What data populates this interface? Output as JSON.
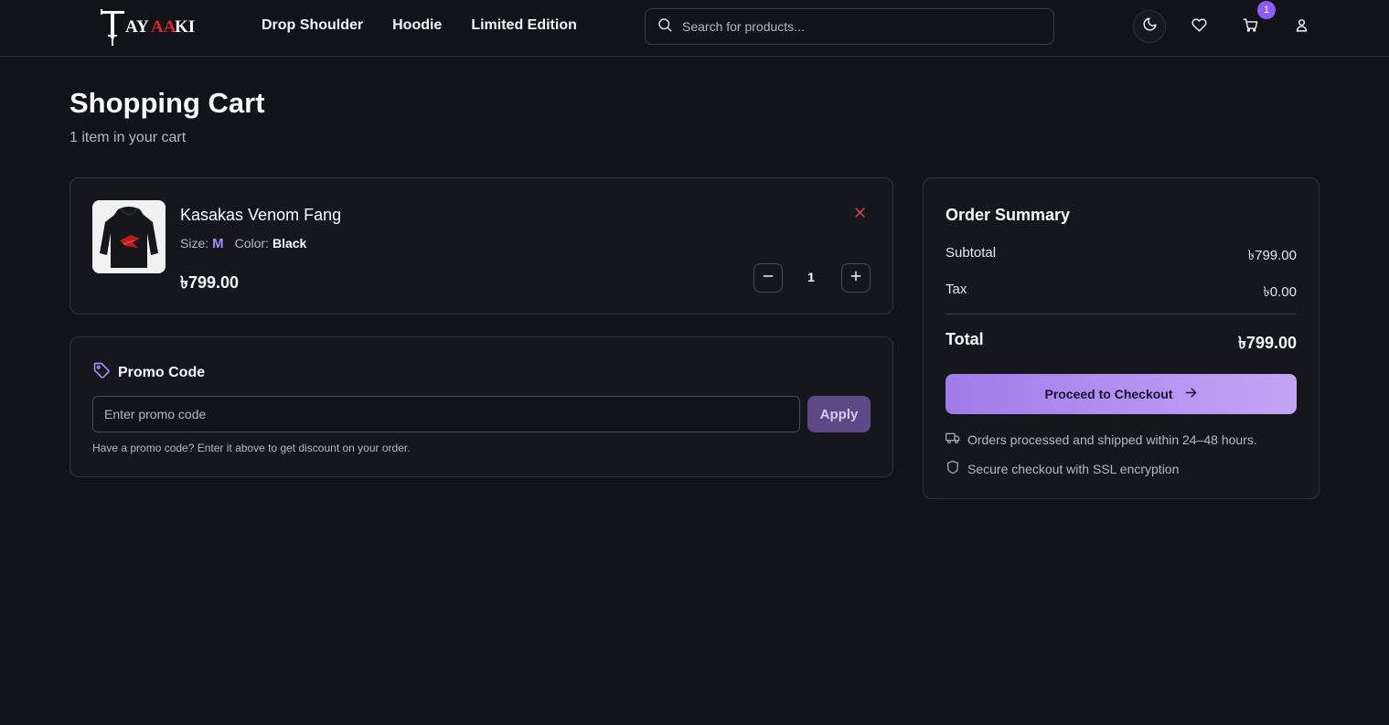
{
  "header": {
    "logo_text": "TAYAAKI",
    "nav": [
      "Drop Shoulder",
      "Hoodie",
      "Limited Edition"
    ],
    "search_placeholder": "Search for products...",
    "cart_count": "1"
  },
  "page": {
    "title": "Shopping Cart",
    "subtitle": "1 item in your cart"
  },
  "cart_item": {
    "name": "Kasakas Venom Fang",
    "size_label": "Size:",
    "size_value": "M",
    "color_label": "Color:",
    "color_value": "Black",
    "price": "৳799.00",
    "quantity": "1"
  },
  "promo": {
    "title": "Promo Code",
    "placeholder": "Enter promo code",
    "apply_label": "Apply",
    "hint": "Have a promo code? Enter it above to get discount on your order."
  },
  "summary": {
    "title": "Order Summary",
    "subtotal_label": "Subtotal",
    "subtotal_value": "৳799.00",
    "tax_label": "Tax",
    "tax_value": "৳0.00",
    "total_label": "Total",
    "total_value": "৳799.00",
    "checkout_label": "Proceed to Checkout",
    "shipping_note": "Orders processed and shipped within 24–48 hours.",
    "secure_note": "Secure checkout with SSL encryption"
  },
  "colors": {
    "accent": "#8b5cf6",
    "background": "#121318",
    "remove": "#ef4444"
  },
  "icons": [
    "search-icon",
    "moon-icon",
    "heart-icon",
    "cart-icon",
    "user-icon",
    "close-icon",
    "minus-icon",
    "plus-icon",
    "tag-icon",
    "arrow-right-icon",
    "truck-icon",
    "shield-icon"
  ]
}
